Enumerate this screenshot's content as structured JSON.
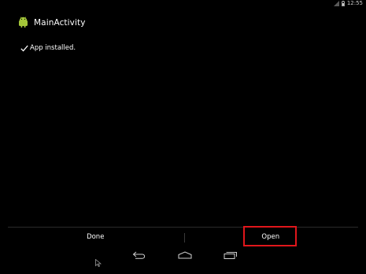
{
  "status_bar": {
    "time": "12:55",
    "battery_icon": "battery-icon",
    "signal_icon": "signal-icon"
  },
  "action_bar": {
    "title": "MainActivity",
    "app_icon": "android-icon"
  },
  "content": {
    "status_text": "App installed.",
    "check_icon": "check-icon"
  },
  "buttons": {
    "done_label": "Done",
    "open_label": "Open"
  },
  "nav_bar": {
    "back_icon": "back-icon",
    "home_icon": "home-icon",
    "recents_icon": "recents-icon"
  },
  "colors": {
    "background": "#000000",
    "text": "#ffffff",
    "android_green": "#a4c639",
    "highlight": "#e0161b"
  }
}
